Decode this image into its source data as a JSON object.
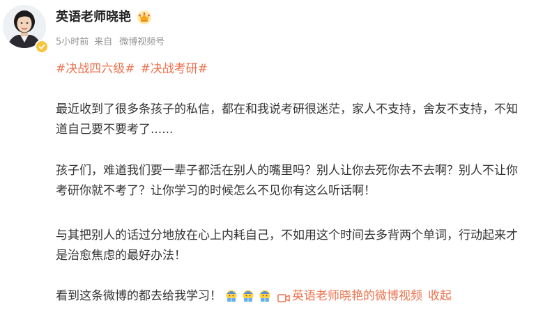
{
  "user": {
    "name": "英语老师晓艳",
    "vip_icon": "crown-vip-icon",
    "verified_icon": "verified-badge-icon",
    "verified_color": "#f8c43a"
  },
  "meta": {
    "time": "5小时前",
    "source_prefix": "来自",
    "source_name": "微博视频号"
  },
  "topics": [
    "#决战四六级#",
    "#决战考研#"
  ],
  "paragraphs": [
    "最近收到了很多条孩子的私信，都在和我说考研很迷茫，家人不支持，舍友不支持，不知道自己要不要考了......",
    "孩子们，难道我们要一辈子都活在别人的嘴里吗？别人让你去死你去不去啊？别人不让你考研你就不考了？让你学习的时候怎么不见你有这么听话啊！",
    "与其把别人的话过分地放在心上内耗自己，不如用这个时间去多背两个单词，行动起来才是治愈焦虑的最好办法！"
  ],
  "last_line": {
    "text": "看到这条微博的都去给我学习！",
    "emojis": [
      "studying-emoji",
      "studying-emoji",
      "studying-emoji"
    ],
    "video_link_text": "英语老师晓艳的微博视频",
    "collapse_text": "收起"
  },
  "colors": {
    "link": "#eb7350",
    "text": "#333333",
    "meta": "#939393"
  }
}
